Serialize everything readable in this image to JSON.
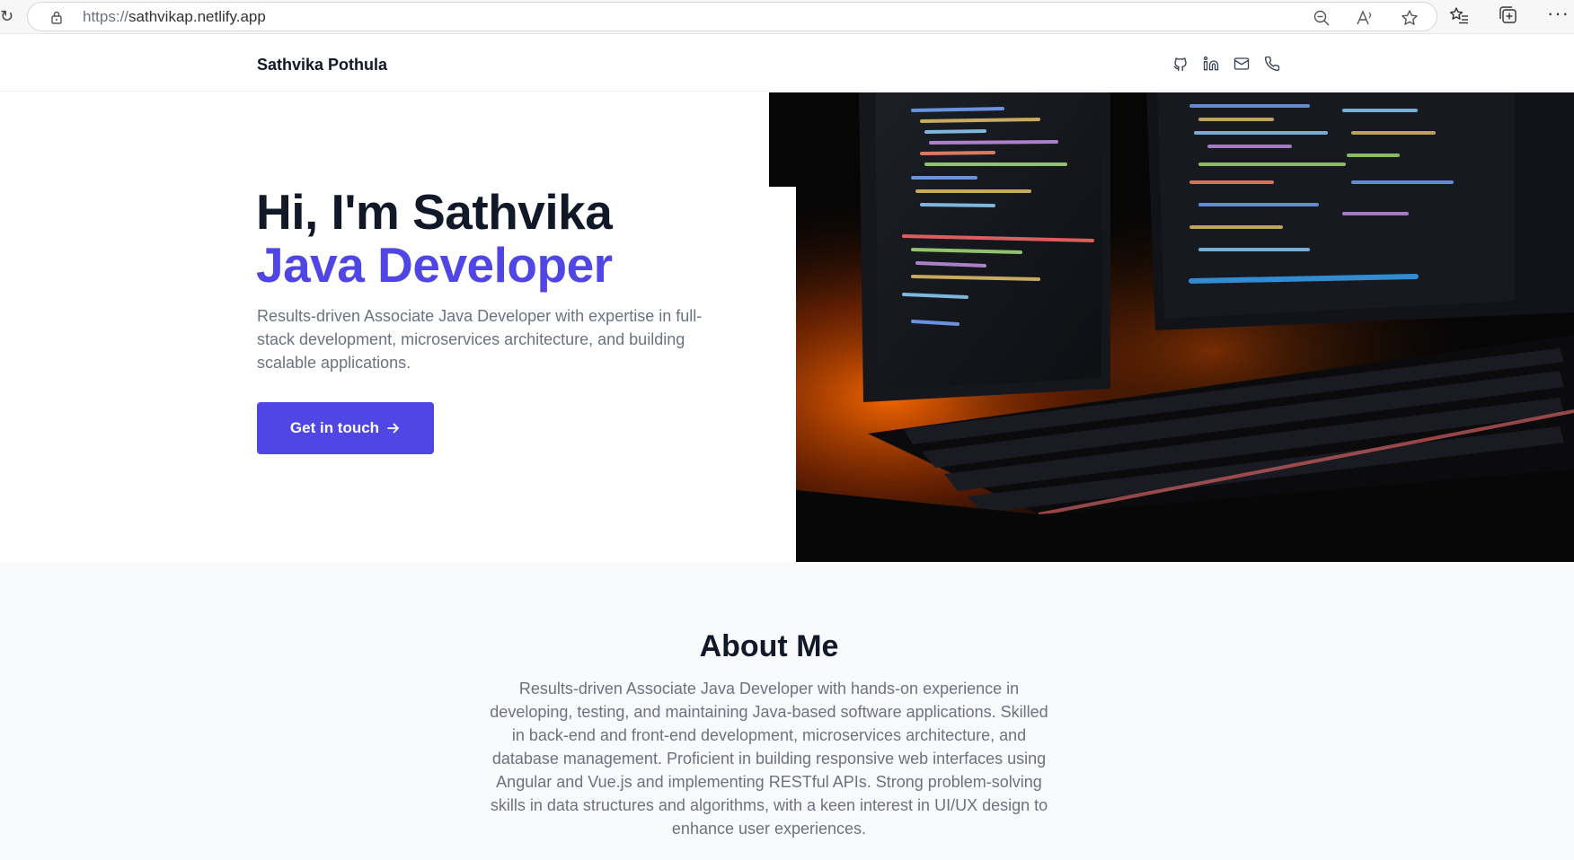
{
  "browser": {
    "url_protocol": "https://",
    "url_host": "sathvikap.netlify.app",
    "icons": [
      "lock-icon",
      "zoom-out-icon",
      "read-aloud-icon",
      "favorite-star-icon",
      "favorites-list-icon",
      "collections-icon",
      "more-icon"
    ],
    "more_glyph": "···"
  },
  "header": {
    "brand": "Sathvika Pothula",
    "social_icons": [
      "github-icon",
      "linkedin-icon",
      "mail-icon",
      "phone-icon"
    ]
  },
  "hero": {
    "greeting": "Hi, I'm Sathvika",
    "role": "Java Developer",
    "description": "Results-driven Associate Java Developer with expertise in full-stack development, microservices architecture, and building scalable applications.",
    "cta_label": "Get in touch",
    "image_subject": "dual monitors with code and backlit keyboard"
  },
  "about": {
    "title": "About Me",
    "text": "Results-driven Associate Java Developer with hands-on experience in developing, testing, and maintaining Java-based software applications. Skilled in back-end and front-end development, microservices architecture, and database management. Proficient in building responsive web interfaces using Angular and Vue.js and implementing RESTful APIs. Strong problem-solving skills in data structures and algorithms, with a keen interest in UI/UX design to enhance user experiences."
  },
  "colors": {
    "accent": "#4f46e5",
    "heading": "#111827",
    "muted_text": "#6b7280",
    "section_bg": "#f9fafb"
  }
}
